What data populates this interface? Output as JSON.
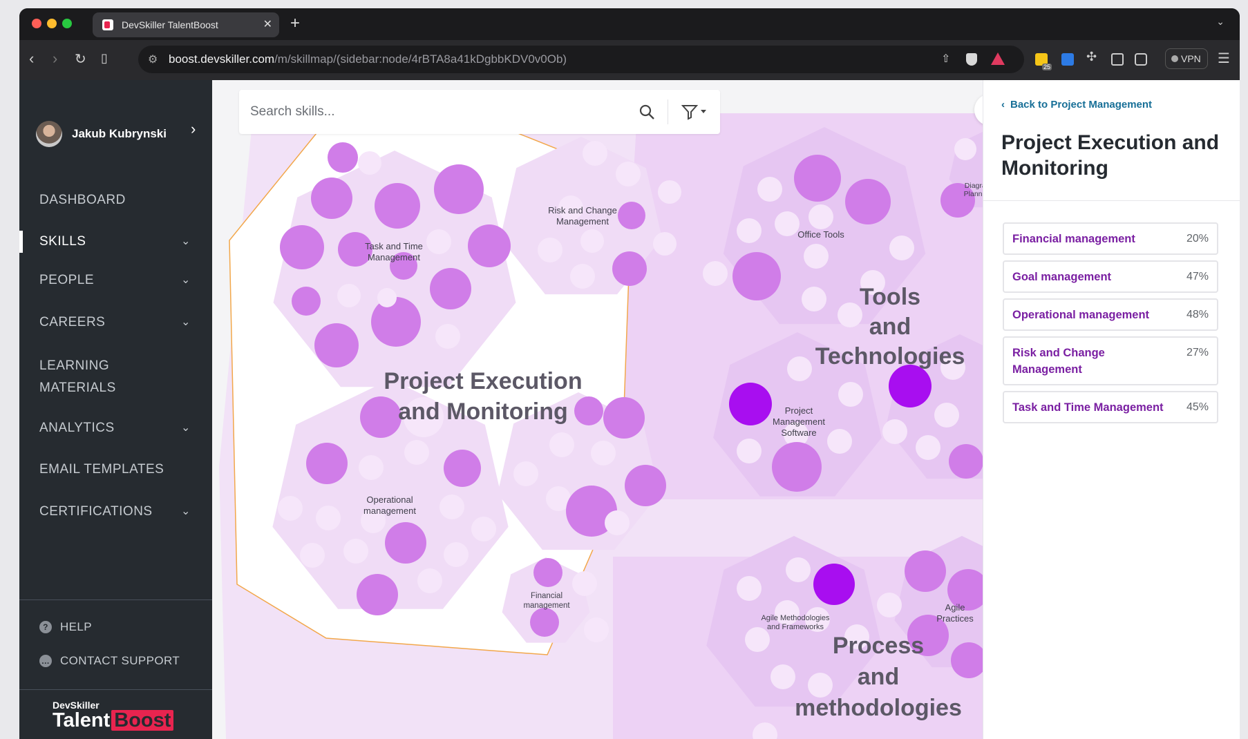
{
  "browser": {
    "tab_title": "DevSkiller TalentBoost",
    "url_host": "boost.devskiller.com",
    "url_path": "/m/skillmap/(sidebar:node/4rBTA8a41kDgbbKDV0v0Ob)",
    "vpn_label": "VPN",
    "extension_badge": "25"
  },
  "sidebar": {
    "user_name": "Jakub Kubrynski",
    "nav": [
      {
        "label": "DASHBOARD",
        "has_submenu": false
      },
      {
        "label": "SKILLS",
        "has_submenu": true,
        "active": true
      },
      {
        "label": "PEOPLE",
        "has_submenu": true
      },
      {
        "label": "CAREERS",
        "has_submenu": true
      },
      {
        "label": "LEARNING MATERIALS",
        "has_submenu": false
      },
      {
        "label": "ANALYTICS",
        "has_submenu": true
      },
      {
        "label": "EMAIL TEMPLATES",
        "has_submenu": false
      },
      {
        "label": "CERTIFICATIONS",
        "has_submenu": true
      }
    ],
    "learning_line1": "LEARNING",
    "learning_line2": "MATERIALS",
    "help_label": "HELP",
    "contact_label": "CONTACT SUPPORT",
    "brand_small": "DevSkiller",
    "brand_talent": "Talent",
    "brand_boost": "Boost"
  },
  "search": {
    "placeholder": "Search skills..."
  },
  "map": {
    "selected_group_line1": "Project Execution",
    "selected_group_line2": "and Monitoring",
    "tools_line1": "Tools",
    "tools_line2": "and",
    "tools_line3": "Technologies",
    "process_line1": "Process",
    "process_line2": "and",
    "process_line3": "methodologies",
    "clusters": {
      "task_time_1": "Task and Time",
      "task_time_2": "Management",
      "risk_1": "Risk and Change",
      "risk_2": "Management",
      "operational_1": "Operational",
      "operational_2": "management",
      "financial_1": "Financial",
      "financial_2": "management",
      "office_tools": "Office Tools",
      "pm_software_1": "Project",
      "pm_software_2": "Management",
      "pm_software_3": "Software",
      "diagramming_1": "Diagramming",
      "diagramming_2": "Planning To",
      "agile_meth_1": "Agile Methodologies",
      "agile_meth_2": "and Frameworks",
      "agile_prac_1": "Agile",
      "agile_prac_2": "Practices"
    },
    "colors": {
      "bubble_dark": "#a80ef0",
      "bubble_mid": "#d07de8",
      "bubble_light": "#f6e6fa",
      "group_bg": "#f0dcf6"
    }
  },
  "panel": {
    "back_label": "Back to Project Management",
    "title": "Project Execution and Monitoring",
    "skills": [
      {
        "name": "Financial management",
        "percent": "20%"
      },
      {
        "name": "Goal management",
        "percent": "47%"
      },
      {
        "name": "Operational management",
        "percent": "48%"
      },
      {
        "name": "Risk and Change Management",
        "percent": "27%"
      },
      {
        "name": "Task and Time Management",
        "percent": "45%"
      }
    ]
  }
}
